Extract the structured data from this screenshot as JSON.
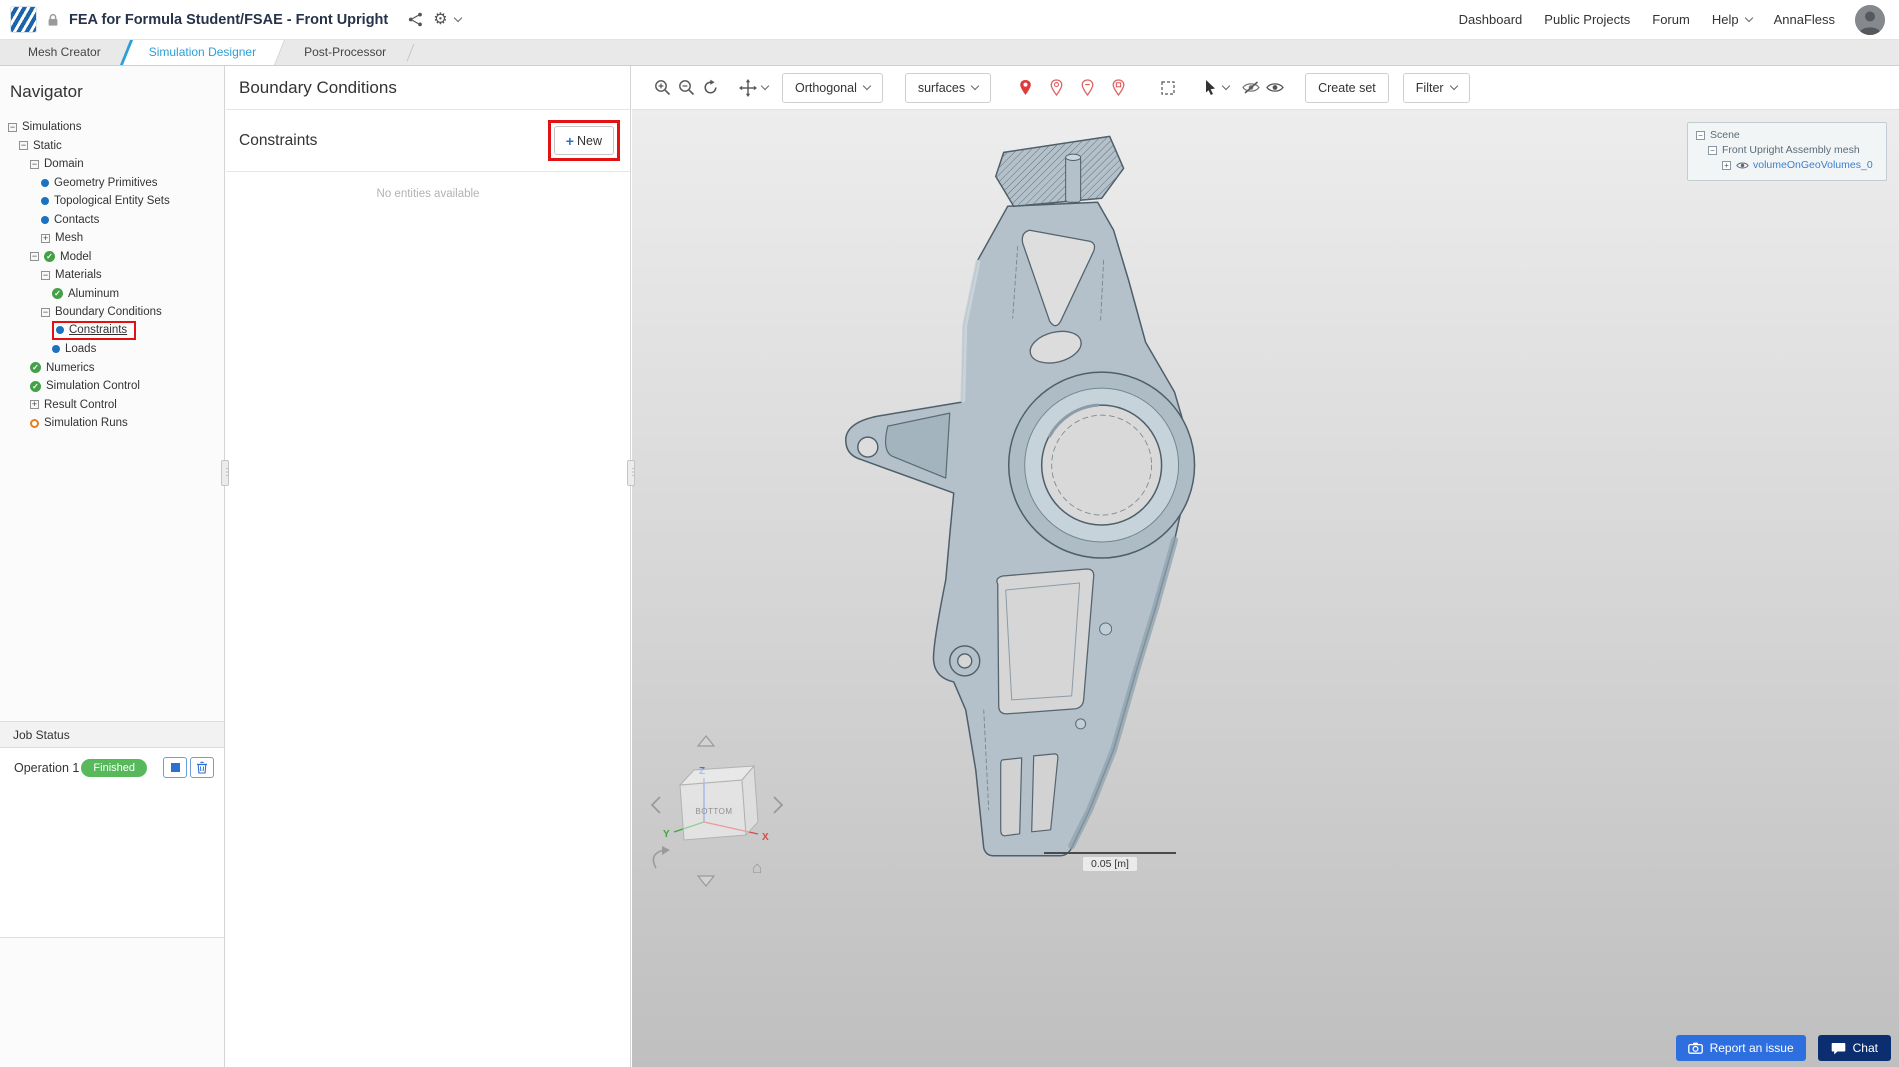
{
  "header": {
    "project_title": "FEA for Formula Student/FSAE - Front Upright",
    "nav_items": [
      {
        "label": "Dashboard",
        "chevron": false
      },
      {
        "label": "Public Projects",
        "chevron": false
      },
      {
        "label": "Forum",
        "chevron": false
      },
      {
        "label": "Help",
        "chevron": true
      },
      {
        "label": "AnnaFless",
        "chevron": false
      }
    ]
  },
  "tabs": [
    {
      "label": "Mesh Creator",
      "active": false
    },
    {
      "label": "Simulation Designer",
      "active": true
    },
    {
      "label": "Post-Processor",
      "active": false
    }
  ],
  "navigator": {
    "title": "Navigator",
    "items": [
      {
        "label": "Simulations",
        "depth": 0,
        "expander": "minus",
        "icon": "none"
      },
      {
        "label": "Static",
        "depth": 1,
        "expander": "minus",
        "icon": "none"
      },
      {
        "label": "Domain",
        "depth": 2,
        "expander": "minus",
        "icon": "none"
      },
      {
        "label": "Geometry Primitives",
        "depth": 3,
        "expander": "none",
        "icon": "dot"
      },
      {
        "label": "Topological Entity Sets",
        "depth": 3,
        "expander": "none",
        "icon": "dot"
      },
      {
        "label": "Contacts",
        "depth": 3,
        "expander": "none",
        "icon": "dot"
      },
      {
        "label": "Mesh",
        "depth": 3,
        "expander": "plus",
        "icon": "none"
      },
      {
        "label": "Model",
        "depth": 2,
        "expander": "minus",
        "icon": "check"
      },
      {
        "label": "Materials",
        "depth": 3,
        "expander": "minus",
        "icon": "none"
      },
      {
        "label": "Aluminum",
        "depth": 4,
        "expander": "none",
        "icon": "check"
      },
      {
        "label": "Boundary Conditions",
        "depth": 3,
        "expander": "minus",
        "icon": "none"
      },
      {
        "label": "Constraints",
        "depth": 4,
        "expander": "none",
        "icon": "dot",
        "selected": true
      },
      {
        "label": "Loads",
        "depth": 4,
        "expander": "none",
        "icon": "dot"
      },
      {
        "label": "Numerics",
        "depth": 2,
        "expander": "none",
        "icon": "check"
      },
      {
        "label": "Simulation Control",
        "depth": 2,
        "expander": "none",
        "icon": "check"
      },
      {
        "label": "Result Control",
        "depth": 2,
        "expander": "plus",
        "icon": "none"
      },
      {
        "label": "Simulation Runs",
        "depth": 2,
        "expander": "none",
        "icon": "ring"
      }
    ]
  },
  "job_status": {
    "title": "Job Status",
    "operation": "Operation 1",
    "status": "Finished"
  },
  "panel": {
    "title": "Boundary Conditions",
    "section_title": "Constraints",
    "new_button": "New",
    "empty_text": "No entities available"
  },
  "viewport": {
    "toolbar": {
      "orthogonal": "Orthogonal",
      "surfaces": "surfaces",
      "create_set": "Create set",
      "filter": "Filter"
    },
    "scene_tree": {
      "root": "Scene",
      "mesh": "Front Upright Assembly mesh",
      "volume": "volumeOnGeoVolumes_0"
    },
    "cube_label": "BOTTOM",
    "axes": {
      "x": "X",
      "y": "Y",
      "z": "Z"
    },
    "scale_label": "0.05 [m]",
    "report_button": "Report an issue",
    "chat_button": "Chat"
  },
  "icons": {
    "gear": "⚙",
    "home": "⌂",
    "plus": "+",
    "minus": "−",
    "check": "✓",
    "dots": "⋮"
  },
  "colors": {
    "tab_active_blue": "#2d9fd6",
    "accent_blue": "#2e6fd0",
    "finished_green": "#57b85c",
    "annotation_red": "#e31212",
    "report_button_blue": "#2e6fe0",
    "chat_button_navy": "#0b2e70",
    "entity_dot_blue": "#1b72bf",
    "pending_orange": "#e87d1e",
    "model_body": "#b4c1ca"
  }
}
